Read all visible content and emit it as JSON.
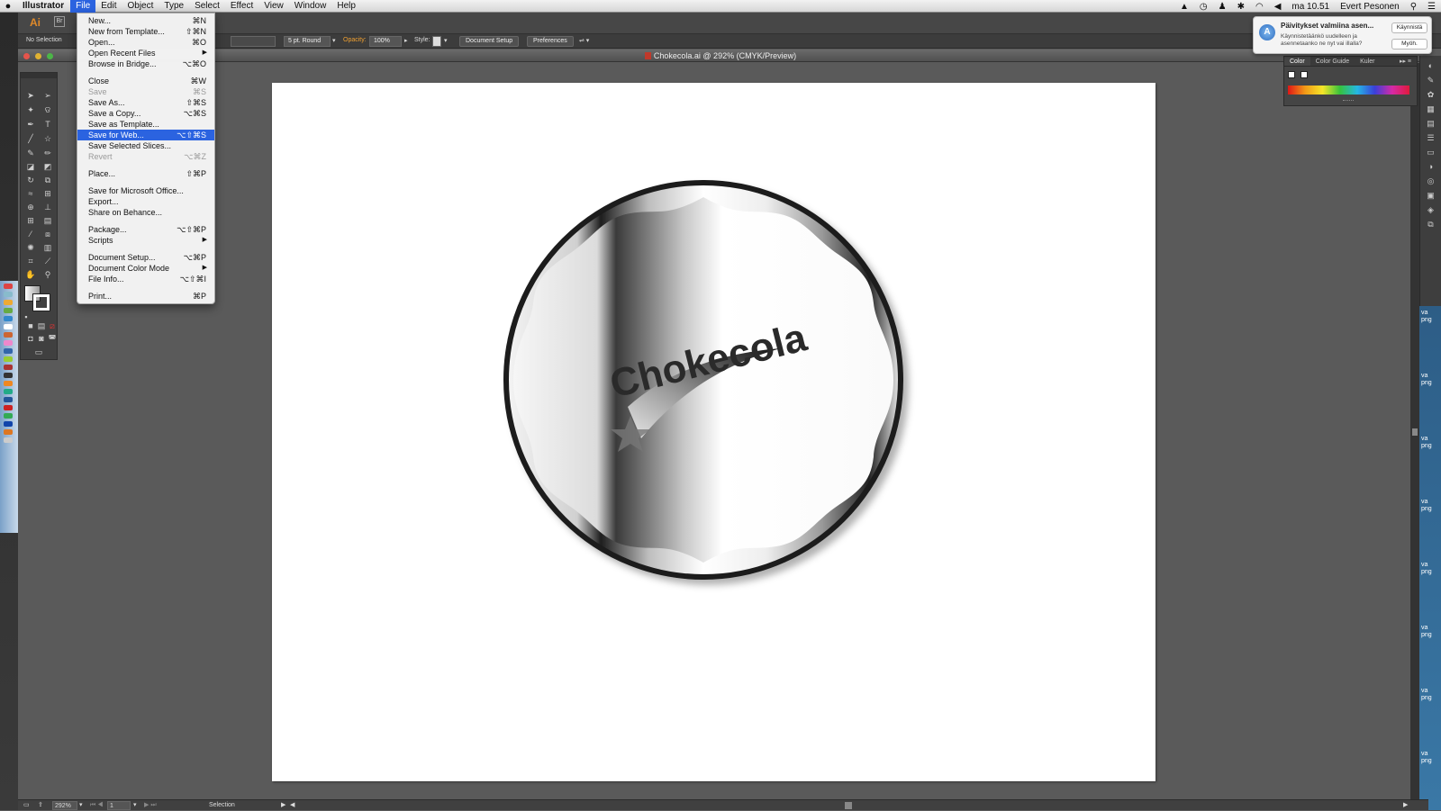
{
  "menubar": {
    "app_name": "Illustrator",
    "menus": [
      "File",
      "Edit",
      "Object",
      "Type",
      "Select",
      "Effect",
      "View",
      "Window",
      "Help"
    ],
    "clock": "ma 10.51",
    "user": "Evert Pesonen"
  },
  "control_bar": {
    "selection": "No Selection",
    "stroke_profile": "5 pt. Round",
    "opacity_label": "Opacity:",
    "opacity_value": "100%",
    "style_label": "Style:",
    "document_setup": "Document Setup",
    "preferences": "Preferences"
  },
  "document": {
    "title": "Chokecola.ai @ 292% (CMYK/Preview)"
  },
  "artwork": {
    "logo_text": "Chokecola"
  },
  "file_menu": {
    "items": [
      {
        "label": "New...",
        "shortcut": "⌘N"
      },
      {
        "label": "New from Template...",
        "shortcut": "⇧⌘N"
      },
      {
        "label": "Open...",
        "shortcut": "⌘O"
      },
      {
        "label": "Open Recent Files",
        "submenu": "▶"
      },
      {
        "label": "Browse in Bridge...",
        "shortcut": "⌥⌘O"
      },
      {
        "label": "Close",
        "shortcut": "⌘W"
      },
      {
        "label": "Save",
        "shortcut": "⌘S"
      },
      {
        "label": "Save As...",
        "shortcut": "⇧⌘S"
      },
      {
        "label": "Save a Copy...",
        "shortcut": "⌥⌘S"
      },
      {
        "label": "Save as Template...",
        "shortcut": ""
      },
      {
        "label": "Save for Web...",
        "shortcut": "⌥⇧⌘S"
      },
      {
        "label": "Save Selected Slices...",
        "shortcut": ""
      },
      {
        "label": "Revert",
        "shortcut": "⌥⌘Z"
      },
      {
        "label": "Place...",
        "shortcut": "⇧⌘P"
      },
      {
        "label": "Save for Microsoft Office...",
        "shortcut": ""
      },
      {
        "label": "Export...",
        "shortcut": ""
      },
      {
        "label": "Share on Behance...",
        "shortcut": ""
      },
      {
        "label": "Package...",
        "shortcut": "⌥⇧⌘P"
      },
      {
        "label": "Scripts",
        "submenu": "▶"
      },
      {
        "label": "Document Setup...",
        "shortcut": "⌥⌘P"
      },
      {
        "label": "Document Color Mode",
        "submenu": "▶"
      },
      {
        "label": "File Info...",
        "shortcut": "⌥⇧⌘I"
      },
      {
        "label": "Print...",
        "shortcut": "⌘P"
      }
    ],
    "highlighted": "Save for Web...",
    "disabled": [
      "Save",
      "Revert"
    ]
  },
  "color_panel": {
    "tabs": [
      "Color",
      "Color Guide",
      "Kuler"
    ]
  },
  "notification": {
    "title": "Päivitykset valmiina asen...",
    "body": "Käynnistetäänkö uudelleen ja asennetaanko ne nyt vai illalla?",
    "restart_button": "Käynnistä",
    "later_button": "Myöh."
  },
  "status_bar": {
    "zoom": "292%",
    "artboard_number": "1",
    "tool": "Selection"
  },
  "desktop_labels": [
    "va",
    "png",
    "va",
    "png",
    "va",
    "png",
    "va",
    "png",
    "va",
    "png",
    "va",
    "png",
    "va",
    "png",
    "va",
    "png"
  ],
  "colors": {
    "accent": "#2b63e0",
    "ai_logo": "#e08a2a"
  }
}
